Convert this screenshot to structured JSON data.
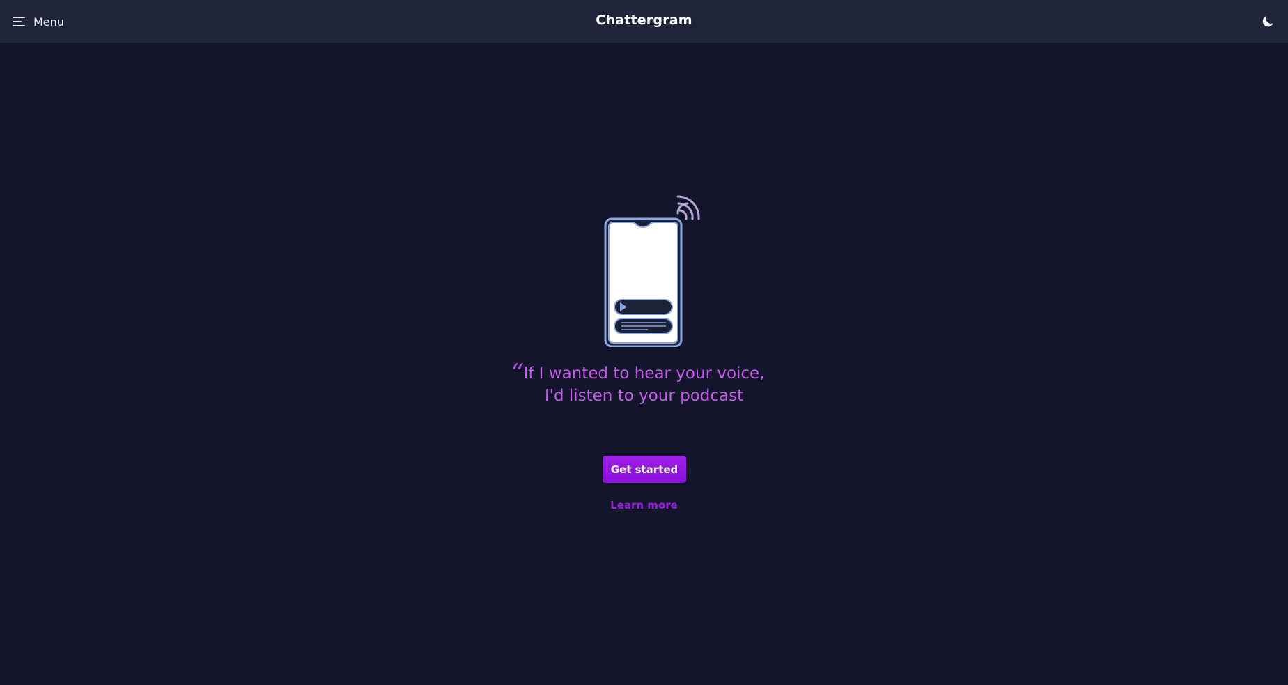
{
  "header": {
    "menu_label": "Menu",
    "menu_icon": "hamburger-icon",
    "title": "Chattergram",
    "theme_icon": "moon-icon"
  },
  "hero": {
    "illustration_icon": "phone-podcast-icon",
    "quote_mark": "“",
    "quote_line_1": "If I wanted to hear your voice,",
    "quote_line_2": "I'd listen to your podcast",
    "primary_button": "Get started",
    "secondary_link": "Learn more"
  },
  "colors": {
    "background": "#13152a",
    "header": "#20243a",
    "accent": "#a020e8",
    "quote": "#c35be8",
    "phone_outline": "#8aa6e0"
  }
}
